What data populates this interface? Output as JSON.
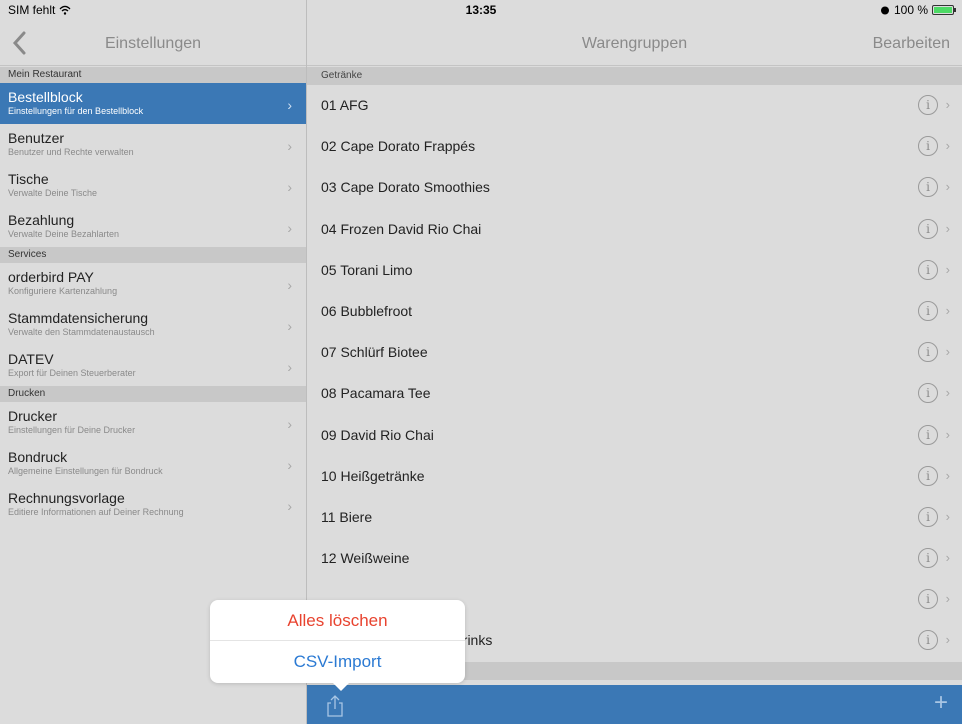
{
  "status_bar": {
    "carrier": "SIM fehlt",
    "time": "13:35",
    "battery": "100 %",
    "battery_level": 1.0
  },
  "left_nav": {
    "title": "Einstellungen",
    "back_icon": "chevron-left-icon"
  },
  "right_nav": {
    "title": "Warengruppen",
    "edit_label": "Bearbeiten"
  },
  "left_sections": [
    {
      "header": "Mein Restaurant",
      "items": [
        {
          "title": "Bestellblock",
          "subtitle": "Einstellungen für den Bestellblock",
          "selected": true
        },
        {
          "title": "Benutzer",
          "subtitle": "Benutzer und Rechte verwalten"
        },
        {
          "title": "Tische",
          "subtitle": "Verwalte Deine Tische"
        },
        {
          "title": "Bezahlung",
          "subtitle": "Verwalte Deine Bezahlarten"
        }
      ]
    },
    {
      "header": "Services",
      "items": [
        {
          "title": "orderbird PAY",
          "subtitle": "Konfiguriere Kartenzahlung"
        },
        {
          "title": "Stammdatensicherung",
          "subtitle": "Verwalte den Stammdatenaustausch"
        },
        {
          "title": "DATEV",
          "subtitle": "Export für Deinen Steuerberater"
        }
      ]
    },
    {
      "header": "Drucken",
      "items": [
        {
          "title": "Drucker",
          "subtitle": "Einstellungen für Deine Drucker"
        },
        {
          "title": "Bondruck",
          "subtitle": "Allgemeine Einstellungen für Bondruck"
        },
        {
          "title": "Rechnungsvorlage",
          "subtitle": "Editiere Informationen auf Deiner Rechnung"
        }
      ]
    }
  ],
  "right_list": {
    "section_header": "Getränke",
    "items": [
      "01 AFG",
      "02 Cape Dorato Frappés",
      "03 Cape Dorato Smoothies",
      "04 Frozen David Rio Chai",
      "05 Torani Limo",
      "06 Bubblefroot",
      "07 Schlürf Biotee",
      "08 Pacamara Tee",
      "09 David Rio Chai",
      "10 Heißgetränke",
      "11 Biere",
      "12 Weißweine",
      "",
      "drinks"
    ],
    "info_glyph": "i",
    "chevron_glyph": "›"
  },
  "toolbar": {
    "share_icon": "share-icon",
    "plus_glyph": "+"
  },
  "popover": {
    "destructive_label": "Alles löschen",
    "action_label": "CSV-Import"
  },
  "colors": {
    "selection": "#3b78b5",
    "toolbar": "#3b78b5",
    "destructive": "#e8432f",
    "action": "#2b7ad3"
  }
}
